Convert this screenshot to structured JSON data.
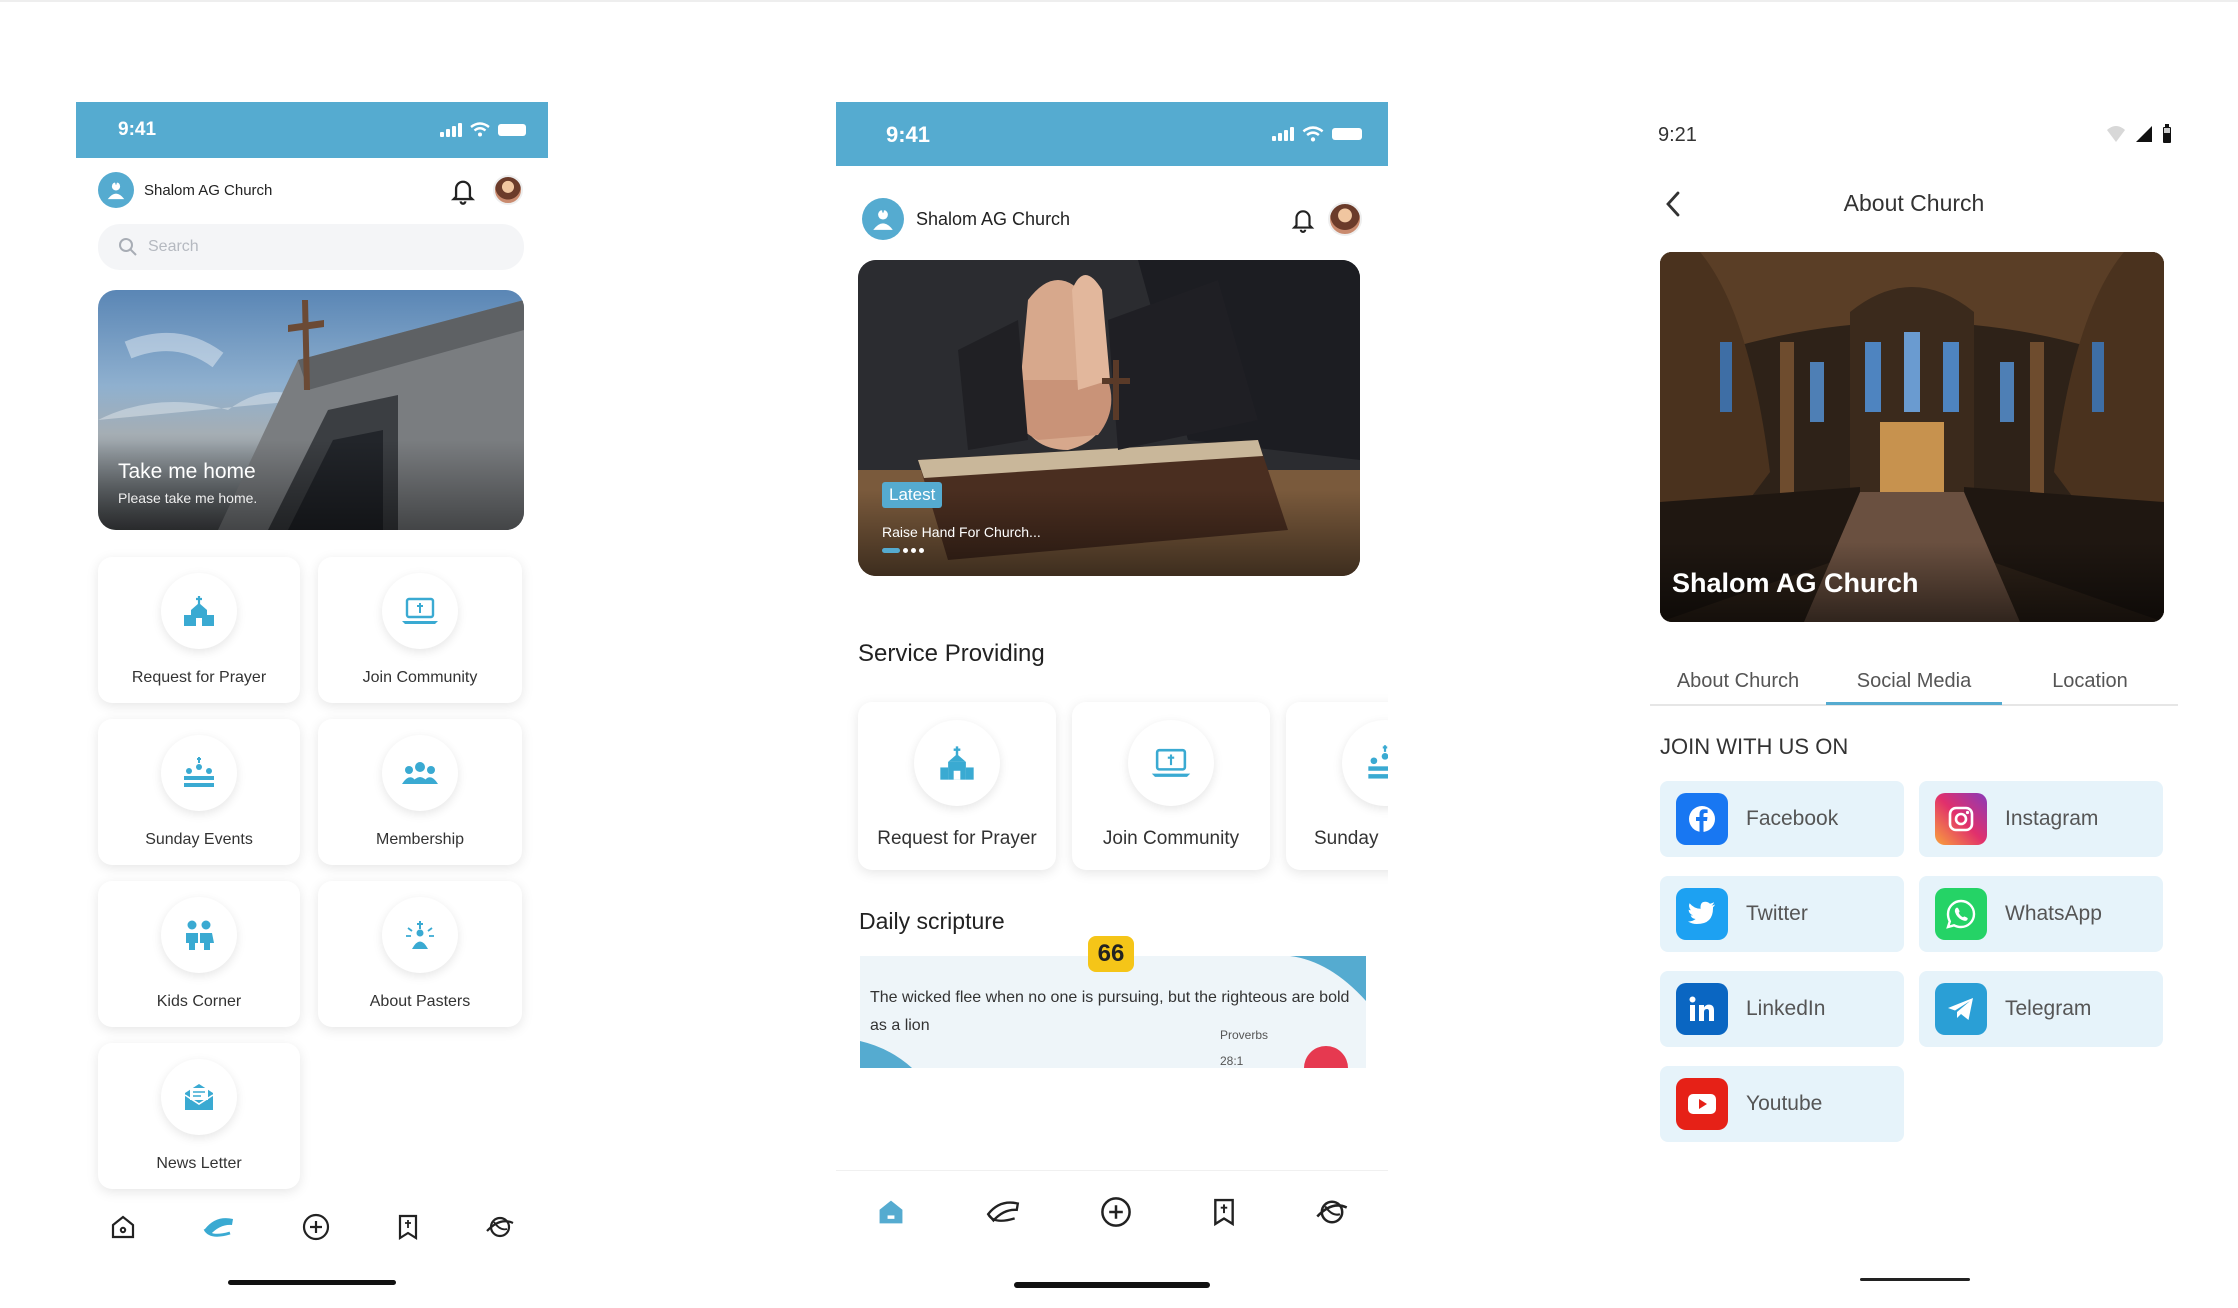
{
  "screen1": {
    "status_time": "9:41",
    "app_name": "Shalom AG Church",
    "search_placeholder": "Search",
    "banner": {
      "title": "Take me home",
      "subtitle": "Please take me home."
    },
    "services": [
      {
        "label": "Request for Prayer",
        "icon": "church-icon"
      },
      {
        "label": "Join Community",
        "icon": "laptop-icon"
      },
      {
        "label": "Sunday Events",
        "icon": "congregation-icon"
      },
      {
        "label": "Membership",
        "icon": "group-icon"
      },
      {
        "label": "Kids Corner",
        "icon": "kids-icon"
      },
      {
        "label": "About Pasters",
        "icon": "pastor-icon"
      },
      {
        "label": "News Letter",
        "icon": "envelope-icon"
      }
    ],
    "nav": [
      "home-icon",
      "bible-icon",
      "add-icon",
      "bookmark-icon",
      "globe-icon"
    ],
    "nav_active": 1
  },
  "screen2": {
    "status_time": "9:41",
    "app_name": "Shalom AG Church",
    "slide": {
      "badge": "Latest",
      "caption": "Raise Hand For Church..."
    },
    "section_services": "Service Providing",
    "services": [
      {
        "label": "Request for Prayer",
        "icon": "church-icon"
      },
      {
        "label": "Join Community",
        "icon": "laptop-icon"
      },
      {
        "label": "Sunday",
        "icon": "congregation-icon"
      }
    ],
    "section_scripture": "Daily scripture",
    "scripture": {
      "quote_mark": "66",
      "text": "The wicked flee when no one is pursuing, but the righteous are bold as a lion",
      "book": "Proverbs",
      "ref": "28:1"
    },
    "nav": [
      "home-icon",
      "bible-icon",
      "add-icon",
      "bookmark-icon",
      "globe-icon"
    ],
    "nav_active": 0
  },
  "screen3": {
    "status_time": "9:21",
    "page_title": "About Church",
    "image_caption": "Shalom AG Church",
    "tabs": [
      "About Church",
      "Social Media",
      "Location"
    ],
    "active_tab": 1,
    "join_heading": "JOIN WITH US ON",
    "socials": [
      {
        "label": "Facebook",
        "color": "#1877f2"
      },
      {
        "label": "Instagram",
        "color": "#e1306c"
      },
      {
        "label": "Twitter",
        "color": "#1da1f2"
      },
      {
        "label": "WhatsApp",
        "color": "#25d366"
      },
      {
        "label": "LinkedIn",
        "color": "#0a66c2"
      },
      {
        "label": "Telegram",
        "color": "#2a9fd6"
      },
      {
        "label": "Youtube",
        "color": "#e62117"
      }
    ]
  }
}
